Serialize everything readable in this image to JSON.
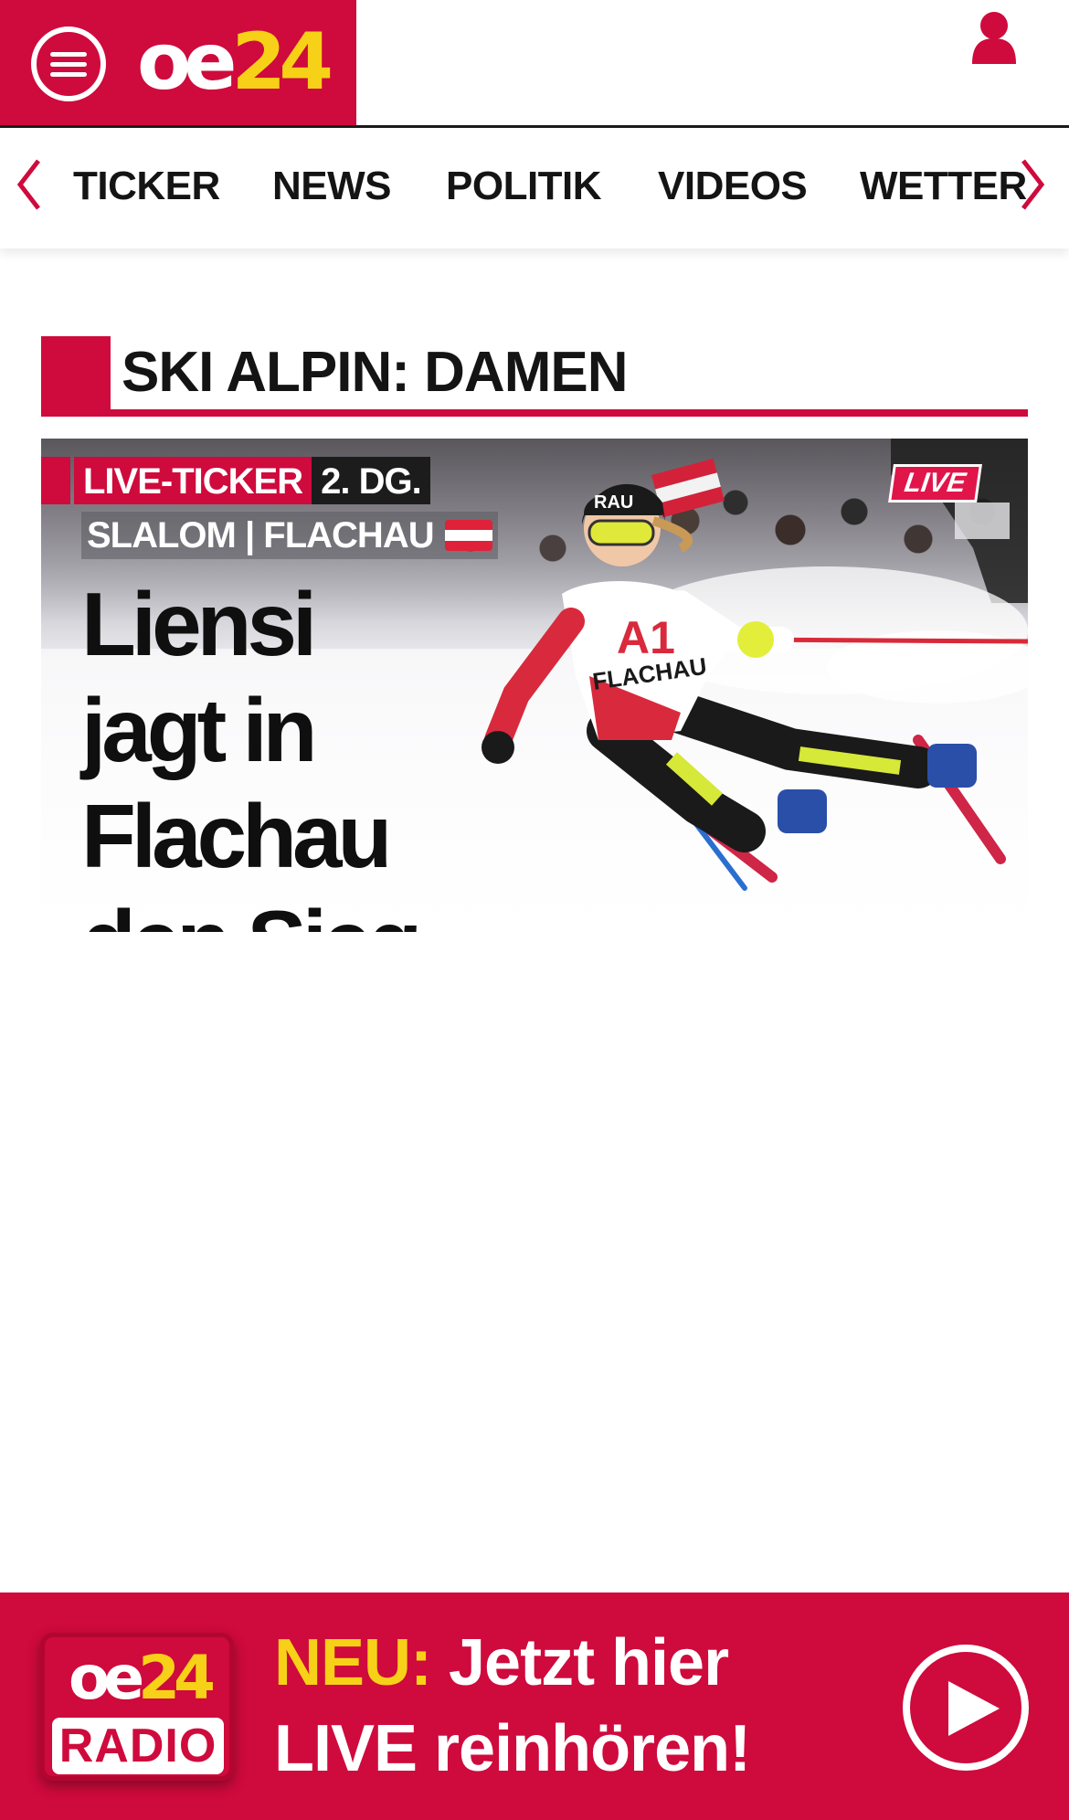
{
  "header": {
    "logo_left": "oe",
    "logo_right": "24",
    "menu_icon": "hamburger-menu-icon",
    "user_icon": "user-icon"
  },
  "nav": {
    "prev_icon": "chevron-left-icon",
    "next_icon": "chevron-right-icon",
    "items": [
      {
        "label": "TICKER"
      },
      {
        "label": "NEWS"
      },
      {
        "label": "POLITIK"
      },
      {
        "label": "VIDEOS"
      },
      {
        "label": "WETTER"
      }
    ]
  },
  "section": {
    "title": "SKI ALPIN: DAMEN"
  },
  "teaser": {
    "kicker_live": "LIVE-TICKER",
    "kicker_race": "2. DG.",
    "kicker_sub": "SLALOM | FLACHAU",
    "headline": "Liensi jagt in Flachau den Sieg",
    "live_badge": "LIVE",
    "bib_sponsor": "A1",
    "bib_place": "FLACHAU",
    "helmet_text": "RAU"
  },
  "radio": {
    "logo_left": "oe",
    "logo_right": "24",
    "logo_sub": "RADIO",
    "text_highlight": "NEU:",
    "text_rest": "Jetzt hier",
    "text_line2": "LIVE reinhören!",
    "play_icon": "play-icon"
  },
  "colors": {
    "brand_red": "#cf0a3c",
    "brand_yellow": "#f7d117",
    "text_dark": "#141414"
  }
}
